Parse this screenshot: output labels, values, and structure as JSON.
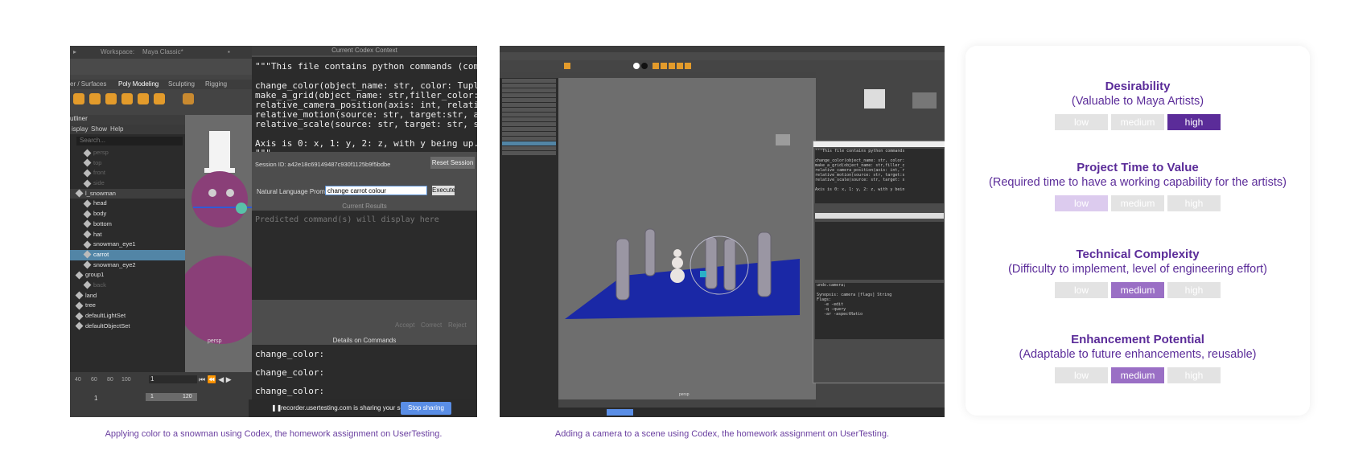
{
  "left_panel": {
    "caption": "Applying color to a snowman using Codex, the homework assignment on UserTesting.",
    "maya": {
      "menu": [
        "Workspace:",
        "Maya Classic*"
      ],
      "shelf_tabs": [
        "er / Surfaces",
        "Poly Modeling",
        "Sculpting",
        "Rigging"
      ],
      "outliner_title": "utliner",
      "outliner_menu": [
        "isplay",
        "Show",
        "Help"
      ],
      "search_placeholder": "Search...",
      "outliner_rows": [
        {
          "label": "persp",
          "state": "dim"
        },
        {
          "label": "top",
          "state": "dim"
        },
        {
          "label": "front",
          "state": "dim"
        },
        {
          "label": "side",
          "state": "dim"
        },
        {
          "label": "l_snowman",
          "state": "group"
        },
        {
          "label": "head",
          "state": "normal"
        },
        {
          "label": "body",
          "state": "normal"
        },
        {
          "label": "bottom",
          "state": "normal"
        },
        {
          "label": "hat",
          "state": "normal"
        },
        {
          "label": "snowman_eye1",
          "state": "normal"
        },
        {
          "label": "carrot",
          "state": "selected"
        },
        {
          "label": "snowman_eye2",
          "state": "normal"
        },
        {
          "label": "group1",
          "state": "normal"
        },
        {
          "label": "back",
          "state": "dim"
        },
        {
          "label": "land",
          "state": "normal"
        },
        {
          "label": "tree",
          "state": "normal"
        },
        {
          "label": "defaultLightSet",
          "state": "normal"
        },
        {
          "label": "defaultObjectSet",
          "state": "normal"
        }
      ],
      "viewport_label": "persp",
      "timeline_ticks": [
        "40",
        "60",
        "80",
        "100"
      ],
      "frame_field": "1",
      "range_start": "1",
      "range_end": "120"
    },
    "codex": {
      "title": "Current Codex Context",
      "code": "\"\"\"This file contains python commands (com\n\nchange_color(object_name: str, color: Tuple\nmake_a_grid(object_name: str,filler_color:\nrelative_camera_position(axis: int, relati\nrelative_motion(source: str, target:str, a\nrelative_scale(source: str, target: str, s\n\nAxis is 0: x, 1: y, 2: z, with y being up.\n\"\"\"",
      "session": "Session ID: a42e18c69149487c930f1125b9f5bdbe",
      "reset_button": "Reset Session",
      "nl_label": "Natural Language Prompt:",
      "prompt_value": "change carrot colour",
      "execute_button": "Execute",
      "results_label": "Current Results",
      "results_placeholder": "Predicted command(s) will display here",
      "accept": "Accept",
      "correct": "Correct",
      "reject": "Reject",
      "details_label": "Details on Commands",
      "details": [
        "change_color:",
        "change_color:",
        "change_color:"
      ]
    },
    "share": {
      "text": "recorder.usertesting.com is sharing your screen.",
      "button": "Stop sharing"
    }
  },
  "middle_panel": {
    "caption": "Adding a camera to a scene using Codex, the homework assignment on UserTesting.",
    "mini_code": "\"\"\"This file contains python commands\n\nchange_color(object_name: str, color:\nmake_a_grid(object_name: str,filler_c\nrelative_camera_position(axis: int, r\nrelative_motion(source: str, target:s\nrelative_scale(source: str, target: s\n\nAxis is 0: x, 1: y, 2: z, with y bein",
    "details_code": "undo.camera;\n\nSynopsis: camera [flags] String\nFlags:\n   -e -edit\n   -q -query\n   -ar -aspectRatio",
    "viewport_label": "persp"
  },
  "rating_card": {
    "level_labels": [
      "low",
      "medium",
      "high"
    ],
    "criteria": [
      {
        "name": "Desirability",
        "description": "(Valuable to Maya Artists)",
        "selected": "high",
        "shade": "strong"
      },
      {
        "name": "Project Time to Value",
        "description": "(Required time to have a working capability for the artists)",
        "selected": "low",
        "shade": "light"
      },
      {
        "name": "Technical Complexity",
        "description": "(Difficulty to implement, level of engineering effort)",
        "selected": "medium",
        "shade": "mid"
      },
      {
        "name": "Enhancement Potential",
        "description": "(Adaptable to future enhancements, reusable)",
        "selected": "medium",
        "shade": "mid"
      }
    ],
    "colors": {
      "accent": "#5b2c99",
      "mid": "#9a6fc5",
      "light": "#dccbee",
      "off": "#e3e3e3"
    }
  }
}
